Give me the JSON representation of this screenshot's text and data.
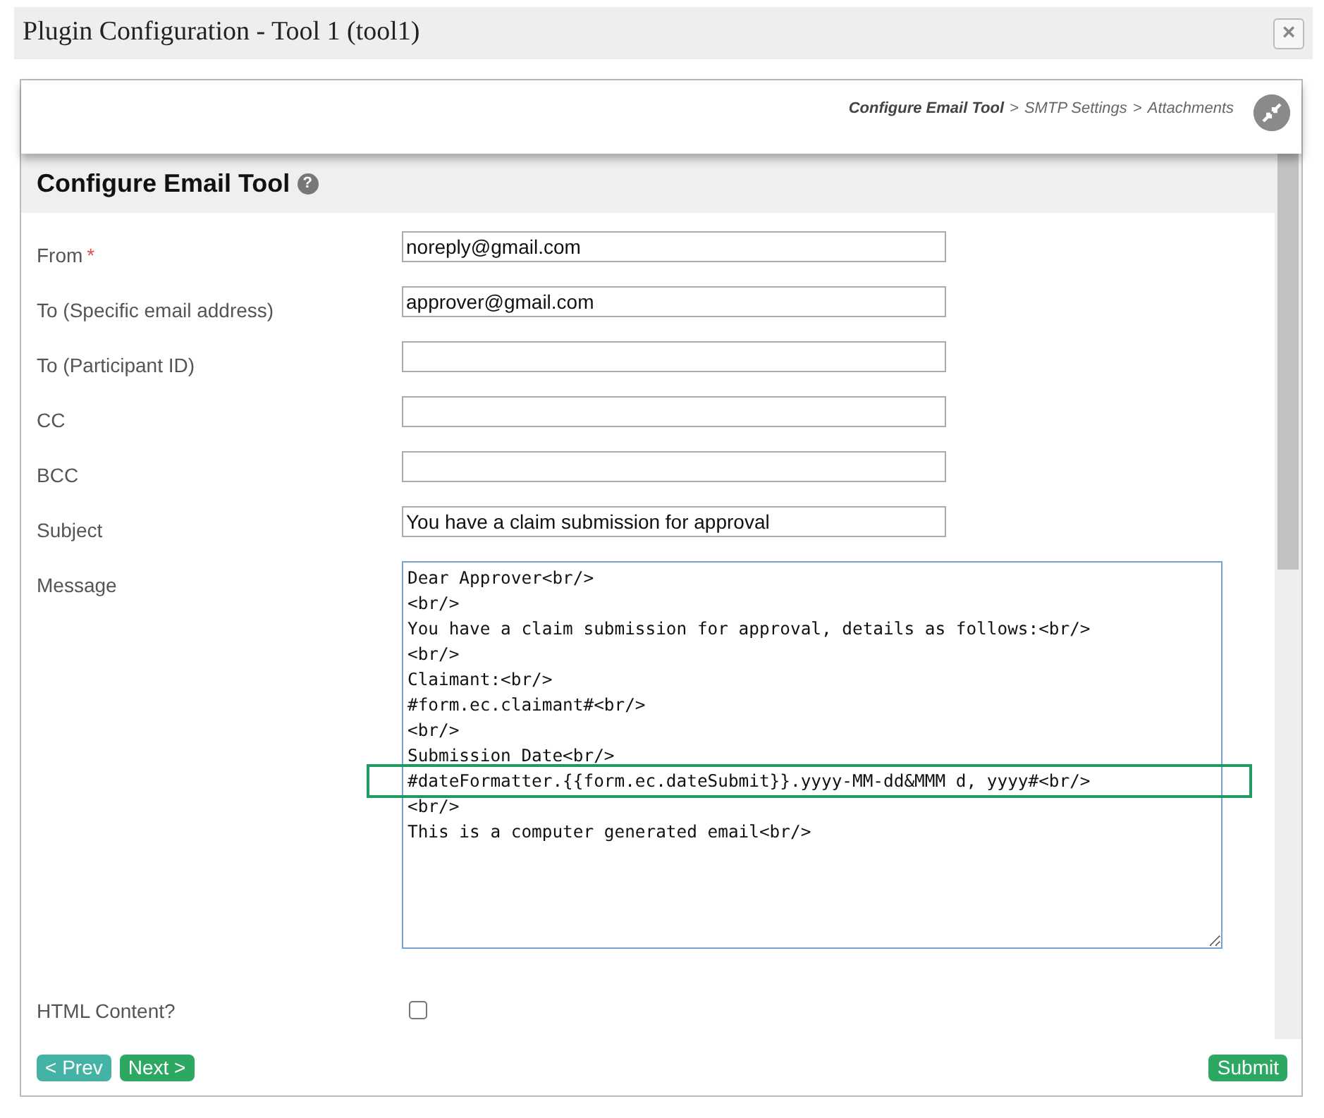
{
  "window": {
    "title": "Plugin Configuration - Tool 1 (tool1)",
    "close": "×"
  },
  "breadcrumb": {
    "separator": ">",
    "steps": [
      {
        "label": "Configure Email Tool",
        "selected": true
      },
      {
        "label": "SMTP Settings",
        "selected": false
      },
      {
        "label": "Attachments",
        "selected": false
      }
    ]
  },
  "section": {
    "title": "Configure Email Tool",
    "help": "?"
  },
  "fields": [
    {
      "kind": "text",
      "label": "From",
      "required_mark": "*",
      "value": "noreply@gmail.com"
    },
    {
      "kind": "text",
      "label": "To (Specific email address)",
      "value": "approver@gmail.com"
    },
    {
      "kind": "text",
      "label": "To (Participant ID)"
    },
    {
      "kind": "text",
      "label": "CC"
    },
    {
      "kind": "text",
      "label": "BCC"
    },
    {
      "kind": "text",
      "label": "Subject",
      "value": "You have a claim submission for approval"
    },
    {
      "kind": "textarea",
      "label": "Message",
      "lines": [
        "Dear Approver<br/>",
        "<br/>",
        "You have a claim submission for approval, details as follows:<br/>",
        "<br/>",
        "Claimant:<br/>",
        "#form.ec.claimant#<br/>",
        "<br/>",
        "Submission Date<br/>",
        "#dateFormatter.{{form.ec.dateSubmit}}.yyyy-MM-dd&MMM d, yyyy#<br/>",
        "<br/>",
        "This is a computer generated email<br/>"
      ]
    },
    {
      "kind": "checkbox",
      "label": "HTML Content?",
      "checked": false
    }
  ],
  "buttons": [
    {
      "kind": "prev",
      "label": "< Prev"
    },
    {
      "kind": "next",
      "label": "Next >"
    },
    {
      "kind": "submit",
      "label": "Submit"
    }
  ]
}
